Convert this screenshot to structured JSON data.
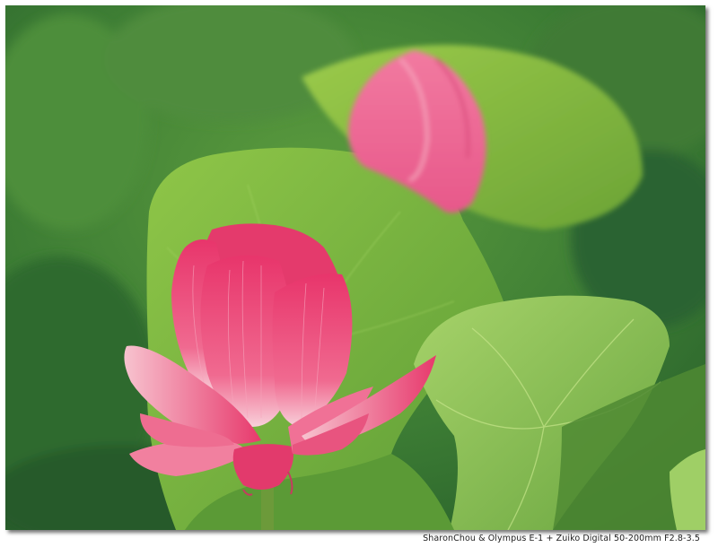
{
  "caption": "SharonChou & Olympus E-1 + Zuiko Digital 50-200mm F2.8-3.5",
  "colors": {
    "background_leaf_dark": "#2f6a2e",
    "background_leaf_mid": "#5a9a3c",
    "leaf_light": "#9ccf4e",
    "lotus_pink": "#e83a6e",
    "lotus_light": "#f7b9c8"
  }
}
